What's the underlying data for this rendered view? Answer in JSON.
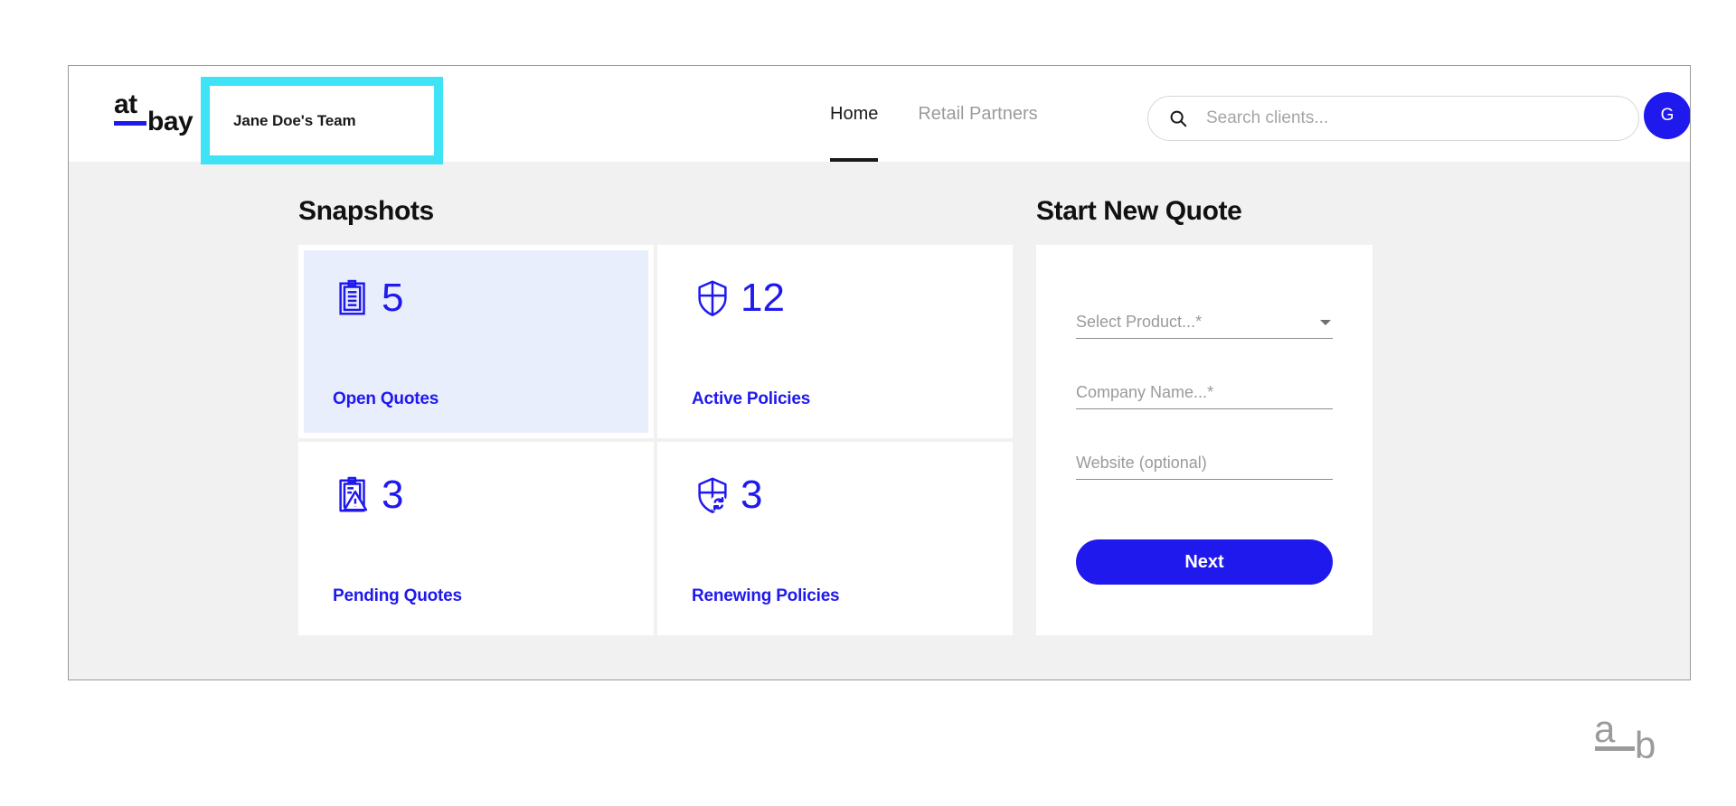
{
  "brand": {
    "logo_top": "at",
    "logo_bottom": "bay"
  },
  "header": {
    "team_name": "Jane Doe's Team",
    "nav": [
      {
        "label": "Home",
        "active": true
      },
      {
        "label": "Retail Partners",
        "active": false
      }
    ],
    "search": {
      "placeholder": "Search clients...",
      "value": "",
      "icon": "search-icon"
    },
    "avatar": {
      "initial": "G",
      "color": "#2019ee"
    }
  },
  "main": {
    "snapshots": {
      "title": "Snapshots",
      "cards": [
        {
          "icon": "clipboard-icon",
          "count": "5",
          "label": "Open Quotes",
          "highlighted": true
        },
        {
          "icon": "shield-cross-icon",
          "count": "12",
          "label": "Active Policies",
          "highlighted": false
        },
        {
          "icon": "clipboard-warning-icon",
          "count": "3",
          "label": "Pending Quotes",
          "highlighted": false
        },
        {
          "icon": "shield-refresh-icon",
          "count": "3",
          "label": "Renewing Policies",
          "highlighted": false
        }
      ]
    },
    "quote": {
      "title": "Start New Quote",
      "fields": [
        {
          "label": "Select Product...",
          "required": true,
          "type": "select",
          "value": ""
        },
        {
          "label": "Company Name...",
          "required": true,
          "type": "text",
          "value": ""
        },
        {
          "label": "Website (optional)",
          "required": false,
          "type": "text",
          "value": ""
        }
      ],
      "submit_label": "Next"
    }
  },
  "watermark": {
    "top": "a",
    "bottom": "b"
  },
  "colors": {
    "accent_blue": "#2019ee",
    "highlight_cyan": "#3ee3f5",
    "card_hover": "#e9eefc",
    "page_bg": "#f1f1f1"
  }
}
